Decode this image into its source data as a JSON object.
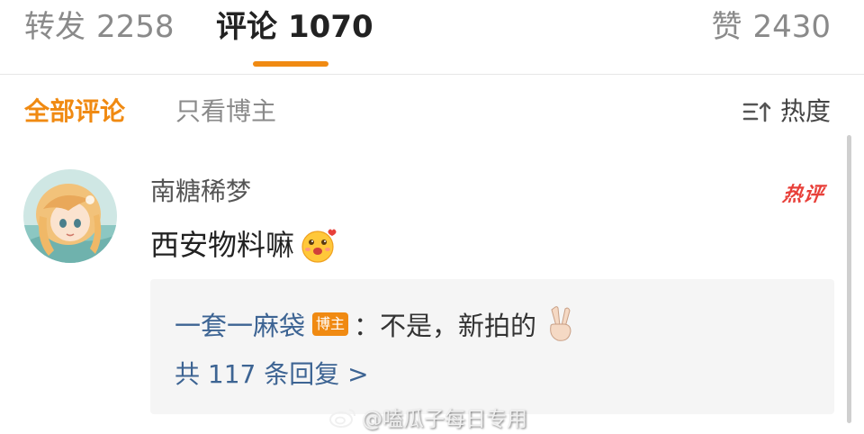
{
  "colors": {
    "accent": "#f08a12",
    "link": "#3d6493",
    "hot": "#e8403a"
  },
  "tabs": {
    "repost": {
      "label": "转发",
      "count": "2258"
    },
    "comments": {
      "label": "评论",
      "count": "1070"
    },
    "likes": {
      "label": "赞",
      "count": "2430"
    }
  },
  "filters": {
    "all": "全部评论",
    "author_only": "只看博主",
    "sort_label": "热度",
    "sort_icon": "sort-icon"
  },
  "comment": {
    "avatar_icon": "avatar-anime-girl",
    "username": "南糖稀梦",
    "hot_badge": "热评",
    "text": "西安物料嘛",
    "emoji_icon": "blushing-face-icon",
    "reply": {
      "user": "一套一麻袋",
      "author_tag": "博主",
      "text": "：不是，新拍的",
      "emoji_icon": "peace-sign-icon",
      "count_label": "共 117 条回复 >"
    }
  },
  "watermark": {
    "icon": "weibo-icon",
    "text": "@嗑瓜子每日专用"
  }
}
